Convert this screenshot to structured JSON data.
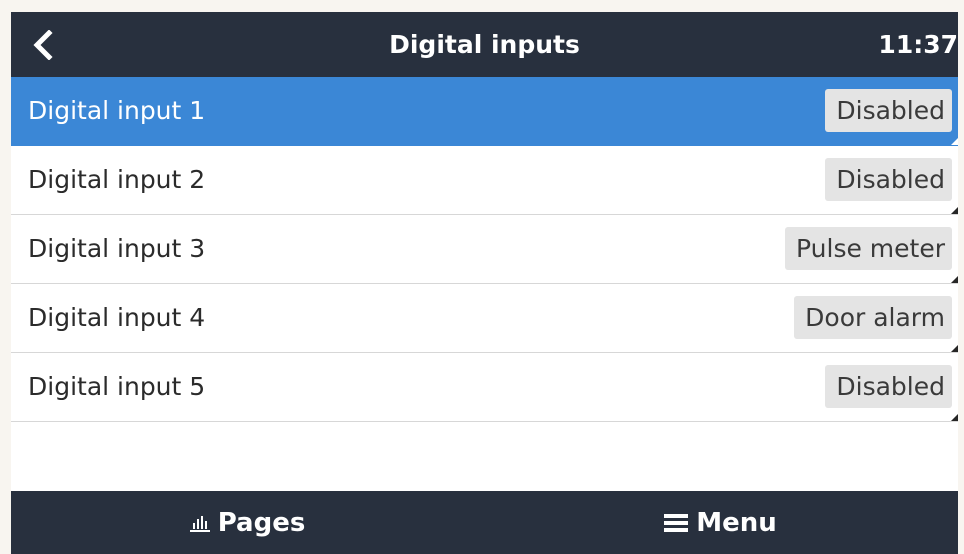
{
  "header": {
    "title": "Digital inputs",
    "time": "11:37",
    "back_icon": "chevron-left-icon"
  },
  "inputs": [
    {
      "label": "Digital input 1",
      "value": "Disabled",
      "selected": true
    },
    {
      "label": "Digital input 2",
      "value": "Disabled",
      "selected": false
    },
    {
      "label": "Digital input 3",
      "value": "Pulse meter",
      "selected": false
    },
    {
      "label": "Digital input 4",
      "value": "Door alarm",
      "selected": false
    },
    {
      "label": "Digital input 5",
      "value": "Disabled",
      "selected": false
    }
  ],
  "footer": {
    "pages_label": "Pages",
    "pages_icon": "bar-chart-icon",
    "menu_label": "Menu",
    "menu_icon": "hamburger-icon"
  },
  "colors": {
    "bar_bg": "#28303e",
    "selected_bg": "#3b87d6",
    "value_bg": "#e4e4e4"
  }
}
